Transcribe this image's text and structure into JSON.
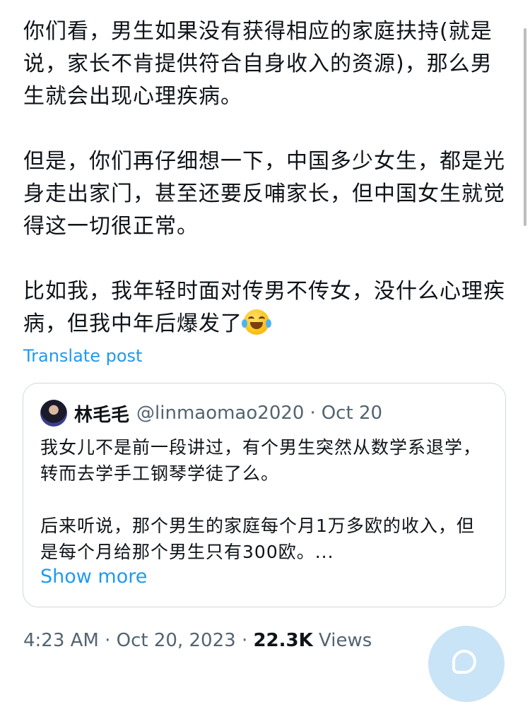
{
  "post": {
    "paragraphs": [
      "你们看，男生如果没有获得相应的家庭扶持(就是说，家长不肯提供符合自身收入的资源)，那么男生就会出现心理疾病。",
      "但是，你们再仔细想一下，中国多少女生，都是光身走出家门，甚至还要反哺家长，但中国女生就觉得这一切很正常。",
      "比如我，我年轻时面对传男不传女，没什么心理疾病，但我中年后爆发了"
    ],
    "emoji_icon": "face-with-tears-of-joy-icon",
    "translate_label": "Translate post"
  },
  "quote": {
    "display_name": "林毛毛",
    "handle": "@linmaomao2020",
    "separator": "·",
    "date": "Oct 20",
    "paragraphs": [
      "我女儿不是前一段讲过，有个男生突然从数学系退学，转而去学手工钢琴学徒了么。",
      "后来听说，那个男生的家庭每个月1万多欧的收入，但是每个月给那个男生只有300欧。..."
    ],
    "show_more_label": "Show more"
  },
  "meta": {
    "time": "4:23 AM",
    "separator1": "·",
    "date": "Oct 20, 2023",
    "separator2": "·",
    "views_count": "22.3K",
    "views_label": "Views"
  },
  "fab": {
    "icon": "reply-compose-icon"
  },
  "colors": {
    "link": "#1d9bf0",
    "text": "#0f1419",
    "secondary": "#536471",
    "border": "#cfd9de",
    "fab": "#c9e4f7"
  }
}
